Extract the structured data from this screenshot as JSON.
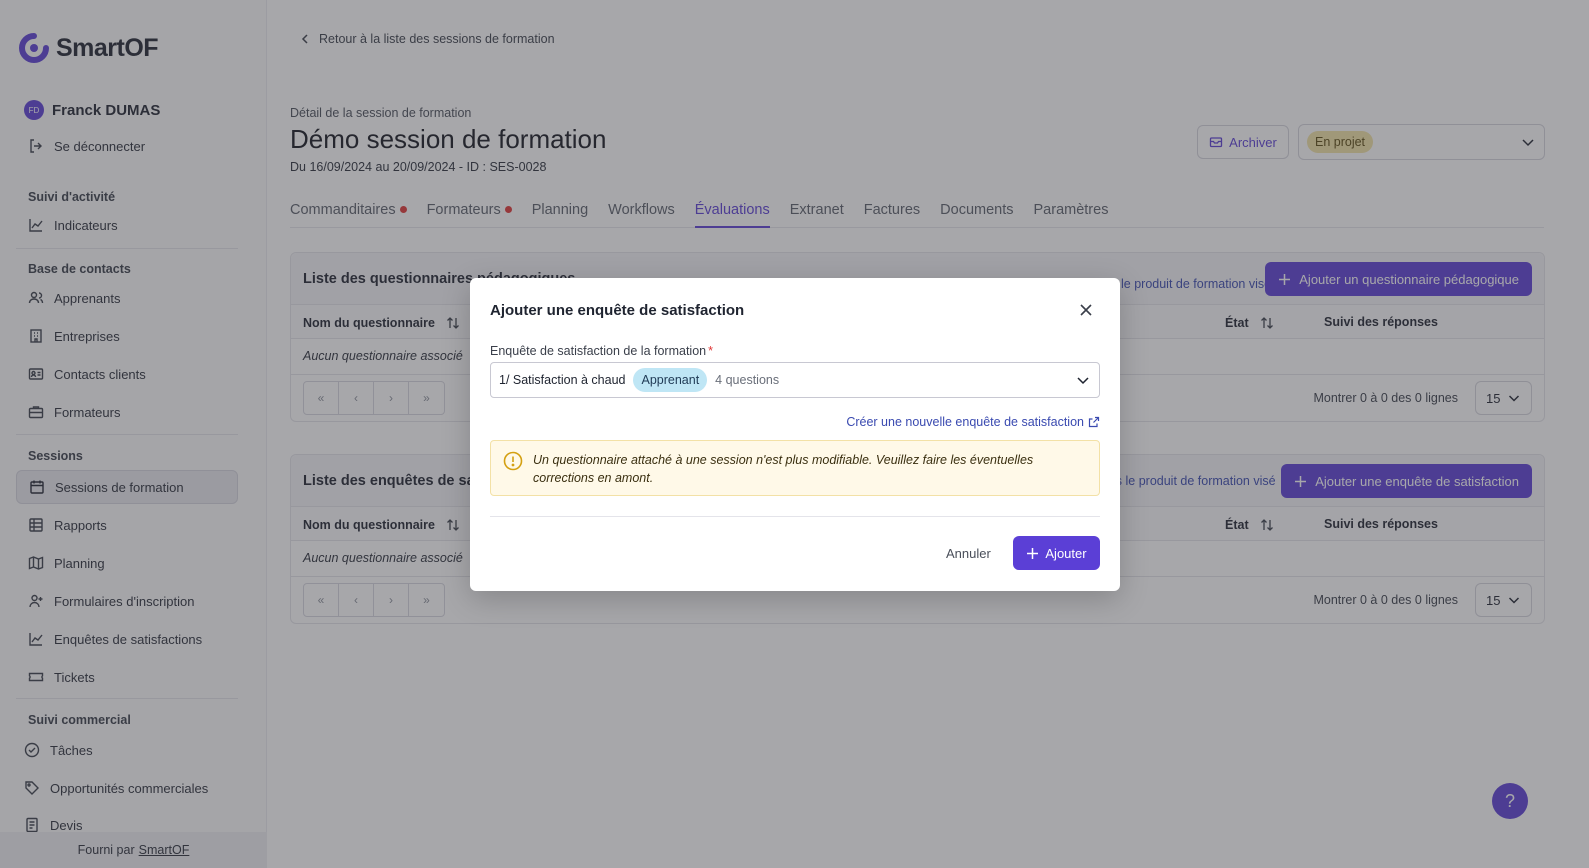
{
  "app": {
    "brand": "SmartOF"
  },
  "user": {
    "initials": "FD",
    "name": "Franck DUMAS",
    "logout": "Se déconnecter"
  },
  "sidebar": {
    "sections": [
      {
        "title": "Suivi d'activité",
        "items": [
          {
            "label": "Indicateurs",
            "icon": "chart-line-icon"
          }
        ]
      },
      {
        "title": "Base de contacts",
        "items": [
          {
            "label": "Apprenants",
            "icon": "users-icon"
          },
          {
            "label": "Entreprises",
            "icon": "building-icon"
          },
          {
            "label": "Contacts clients",
            "icon": "contact-card-icon"
          },
          {
            "label": "Formateurs",
            "icon": "briefcase-icon"
          }
        ]
      },
      {
        "title": "Sessions",
        "items": [
          {
            "label": "Sessions de formation",
            "icon": "calendar-icon",
            "active": true
          },
          {
            "label": "Rapports",
            "icon": "table-icon"
          },
          {
            "label": "Planning",
            "icon": "map-icon"
          },
          {
            "label": "Formulaires d'inscription",
            "icon": "user-plus-icon"
          },
          {
            "label": "Enquêtes de satisfactions",
            "icon": "chart-line-icon"
          },
          {
            "label": "Tickets",
            "icon": "ticket-icon"
          }
        ]
      },
      {
        "title": "Suivi commercial",
        "items": [
          {
            "label": "Tâches",
            "icon": "check-circle-icon"
          },
          {
            "label": "Opportunités commerciales",
            "icon": "tag-icon"
          },
          {
            "label": "Devis",
            "icon": "document-icon"
          }
        ]
      }
    ],
    "footer": {
      "prefix": "Fourni par",
      "link": "SmartOF"
    }
  },
  "header": {
    "back_link": "Retour à la liste des sessions de formation",
    "subtitle": "Détail de la session de formation",
    "title": "Démo session de formation",
    "dates": "Du 16/09/2024 au 20/09/2024 - ID : SES-0028",
    "archive_label": "Archiver",
    "status": "En projet"
  },
  "tabs": [
    {
      "label": "Commanditaires",
      "dot": true
    },
    {
      "label": "Formateurs",
      "dot": true
    },
    {
      "label": "Planning",
      "dot": false
    },
    {
      "label": "Workflows",
      "dot": false
    },
    {
      "label": "Évaluations",
      "dot": false,
      "active": true
    },
    {
      "label": "Extranet",
      "dot": false
    },
    {
      "label": "Factures",
      "dot": false
    },
    {
      "label": "Documents",
      "dot": false
    },
    {
      "label": "Paramètres",
      "dot": false
    }
  ],
  "cards": {
    "pedago": {
      "title": "Liste des questionnaires pédagogiques",
      "link": "le produit de formation visé",
      "button": "Ajouter un questionnaire pédagogique",
      "col_name": "Nom du questionnaire",
      "col_state": "État",
      "col_follow": "Suivi des réponses",
      "empty": "Aucun questionnaire associé",
      "rows_info": "Montrer 0 à 0 des 0 lignes",
      "page_size": "15"
    },
    "satisf": {
      "title": "Liste des enquêtes de satisfaction",
      "link": "is le produit de formation visé",
      "button": "Ajouter une enquête de satisfaction",
      "col_name": "Nom du questionnaire",
      "col_state": "État",
      "col_follow": "Suivi des réponses",
      "empty": "Aucun questionnaire associé",
      "rows_info": "Montrer 0 à 0 des 0 lignes",
      "page_size": "15"
    }
  },
  "modal": {
    "title": "Ajouter une enquête de satisfaction",
    "field_label": "Enquête de satisfaction de la formation",
    "required_mark": "*",
    "selected_value": "1/ Satisfaction à chaud",
    "selected_badge": "Apprenant",
    "selected_count": "4 questions",
    "create_link": "Créer une nouvelle enquête de satisfaction",
    "warning": "Un questionnaire attaché à une session n'est plus modifiable. Veuillez faire les éventuelles corrections en amont.",
    "cancel": "Annuler",
    "submit": "Ajouter"
  },
  "help": {
    "label": "?"
  },
  "colors": {
    "accent": "#5b3fd6",
    "danger": "#e03636",
    "warning_bg": "#fff9e8",
    "status_badge": "#f3e3a6",
    "info_badge": "#bfe6f5"
  }
}
